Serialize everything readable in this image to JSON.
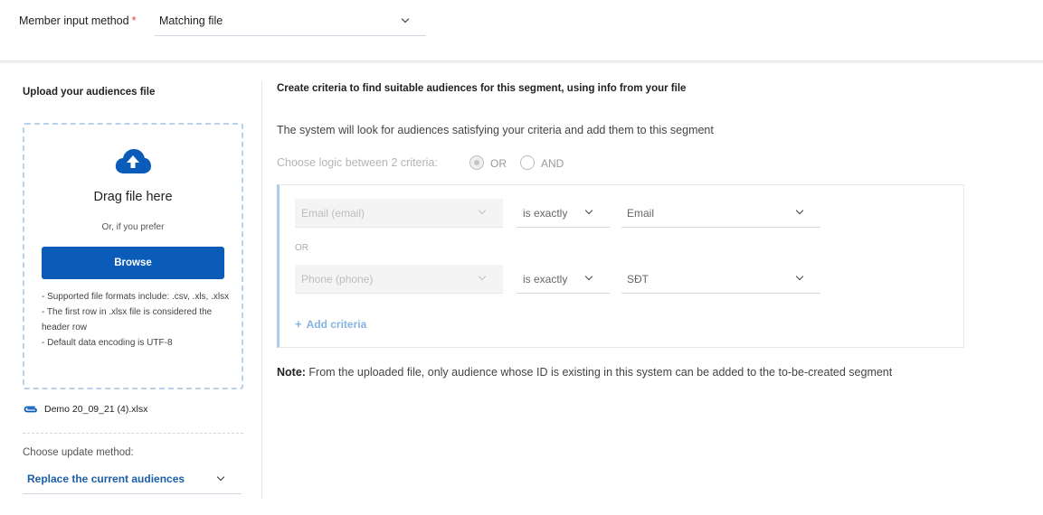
{
  "top": {
    "member_input_label": "Member input method",
    "required_mark": "*",
    "member_input_value": "Matching file"
  },
  "upload": {
    "title": "Upload your audiences file",
    "drag_text": "Drag file here",
    "or_text": "Or, if you prefer",
    "browse_label": "Browse",
    "notes": [
      "- Supported file formats include: .csv, .xls, .xlsx",
      "- The first row in .xlsx file is considered the header row",
      "- Default data encoding is UTF-8"
    ],
    "file_name": "Demo 20_09_21 (4).xlsx",
    "update_method_label": "Choose update method:",
    "update_method_value": "Replace the current audiences"
  },
  "criteria": {
    "title": "Create criteria to find suitable audiences for this segment, using info from your file",
    "description": "The system will look for audiences satisfying your criteria and add them to this segment",
    "logic_label": "Choose logic between 2 criteria:",
    "logic_options": [
      "OR",
      "AND"
    ],
    "logic_selected": "OR",
    "rows": [
      {
        "field": "Email (email)",
        "operator": "is exactly",
        "value": "Email"
      },
      {
        "field": "Phone (phone)",
        "operator": "is exactly",
        "value": "SĐT"
      }
    ],
    "separator": "OR",
    "add_label": "Add criteria",
    "add_icon": "+"
  },
  "note": {
    "prefix": "Note:",
    "text": " From the uploaded file, only audience whose ID is existing in this system can be added to the to-be-created segment"
  },
  "colors": {
    "primary": "#0b5cb8",
    "link": "#1b5fa8",
    "accent_border": "#a9cdee",
    "required": "#e0443a"
  },
  "icons": [
    "cloud-upload-icon",
    "paperclip-icon",
    "chevron-down-icon",
    "plus-icon"
  ]
}
